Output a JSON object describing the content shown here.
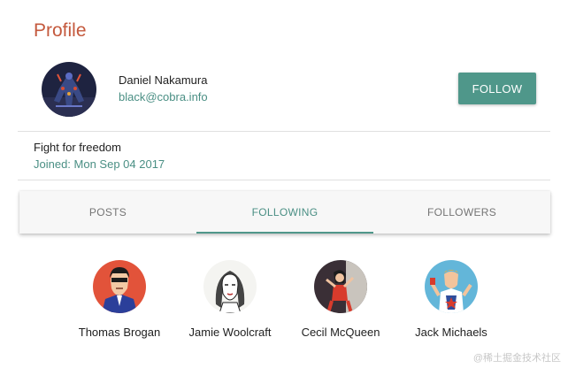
{
  "page": {
    "title": "Profile"
  },
  "user": {
    "name": "Daniel Nakamura",
    "email": "black@cobra.info",
    "bio": "Fight for freedom",
    "joined": "Joined: Mon Sep 04 2017"
  },
  "actions": {
    "follow_label": "FOLLOW"
  },
  "tabs": [
    {
      "label": "POSTS",
      "active": false
    },
    {
      "label": "FOLLOWING",
      "active": true
    },
    {
      "label": "FOLLOWERS",
      "active": false
    }
  ],
  "following": [
    {
      "name": "Thomas Brogan"
    },
    {
      "name": "Jamie Woolcraft"
    },
    {
      "name": "Cecil McQueen"
    },
    {
      "name": "Jack Michaels"
    }
  ],
  "watermark": "@稀土掘金技术社区",
  "colors": {
    "title": "#c4593d",
    "accent": "#4f978a",
    "link": "#4a8f84"
  }
}
